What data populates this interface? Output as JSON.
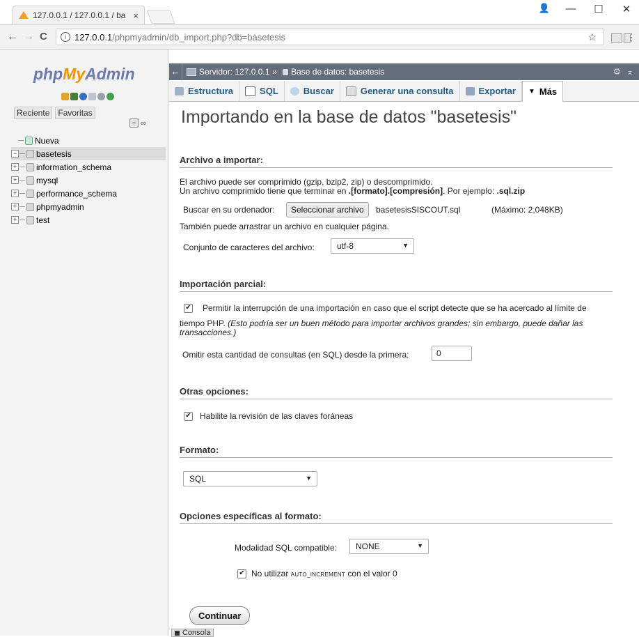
{
  "browser": {
    "tab_title": "127.0.0.1 / 127.0.0.1 / ba",
    "tab_close": "×",
    "url_host": "127.0.0.1",
    "url_path": "/phpmyadmin/db_import.php?db=basetesis",
    "back": "←",
    "forward": "→",
    "reload": "C",
    "info": "i",
    "bookmark_star": "☆",
    "menu": "⋮",
    "window": {
      "account": "👤",
      "minimize": "—",
      "maximize": "☐",
      "close": "✕"
    }
  },
  "sidebar": {
    "logo_php": "php",
    "logo_my": "My",
    "logo_admin": "Admin",
    "tabs": [
      "Reciente",
      "Favoritas"
    ],
    "collapse_symbol": "−",
    "link_symbol": "∞",
    "items": [
      {
        "label": "Nueva",
        "expander": ""
      },
      {
        "label": "basetesis",
        "expander": "−"
      },
      {
        "label": "information_schema",
        "expander": "+"
      },
      {
        "label": "mysql",
        "expander": "+"
      },
      {
        "label": "performance_schema",
        "expander": "+"
      },
      {
        "label": "phpmyadmin",
        "expander": "+"
      },
      {
        "label": "test",
        "expander": "+"
      }
    ]
  },
  "breadcrumb": {
    "back": "←",
    "server": "Servidor: 127.0.0.1",
    "separator": "»",
    "database": "Base de datos: basetesis",
    "gear": "⚙",
    "collapse": "⌅"
  },
  "tabs": [
    {
      "label": "Estructura"
    },
    {
      "label": "SQL"
    },
    {
      "label": "Buscar"
    },
    {
      "label": "Generar una consulta"
    },
    {
      "label": "Exportar"
    },
    {
      "label": "Más"
    }
  ],
  "more_arrow": "▼",
  "page_title": "Importando en la base de datos \"basetesis\"",
  "file_section": {
    "heading": "Archivo a importar:",
    "desc_line1": "El archivo puede ser comprimido (gzip, bzip2, zip) o descomprimido.",
    "desc_line2_a": "Un archivo comprimido tiene que terminar en ",
    "desc_line2_b": ".[formato].[compresión]",
    "desc_line2_c": ". Por ejemplo: ",
    "desc_line2_d": ".sql.zip",
    "browse_label": "Buscar en su ordenador:",
    "browse_button": "Seleccionar archivo",
    "file_name": "basetesisSISCOUT.sql",
    "max_size": "(Máximo: 2,048KB)",
    "drag_text": "También puede arrastrar un archivo en cualquier página.",
    "charset_label": "Conjunto de caracteres del archivo:",
    "charset_value": "utf-8"
  },
  "partial_section": {
    "heading": "Importación parcial:",
    "checked": "✔",
    "allow_interrupt_1": "Permitir la interrupción de una importación en caso que el script detecte que se ha acercado al límite de",
    "allow_interrupt_2a": "tiempo PHP. ",
    "allow_interrupt_2b": "(Esto podría ser un buen método para importar archivos grandes; sin embargo, puede dañar las",
    "allow_interrupt_3": "transacciones.)",
    "skip_label": "Omitir esta cantidad de consultas (en SQL) desde la primera:",
    "skip_value": "0"
  },
  "other_section": {
    "heading": "Otras opciones:",
    "checked": "✔",
    "fk_label": "Habilite la revisión de las claves foráneas"
  },
  "format_section": {
    "heading": "Formato:",
    "value": "SQL"
  },
  "format_options": {
    "heading": "Opciones específicas al formato:",
    "compat_label": "Modalidad SQL compatible:",
    "compat_value": "NONE",
    "checked": "✔",
    "autoinc_a": "No utilizar ",
    "autoinc_code": "AUTO_INCREMENT",
    "autoinc_b": " con el valor 0"
  },
  "dropdown_arrow": "▼",
  "submit": "Continuar",
  "console": "Consola"
}
